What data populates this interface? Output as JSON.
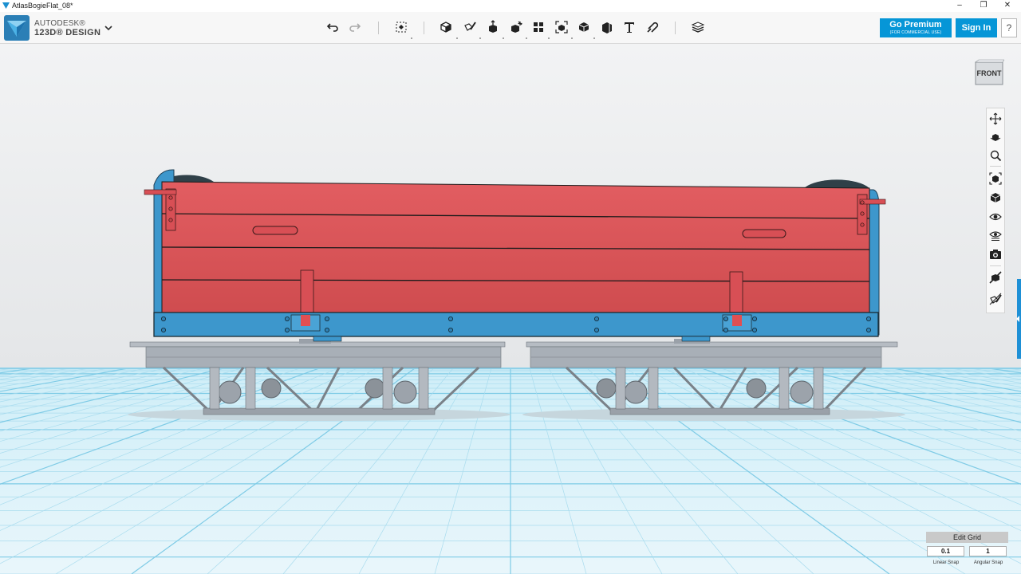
{
  "window": {
    "title": "AtlasBogieFlat_08*",
    "controls": [
      "minimize-icon",
      "maximize-icon",
      "close-icon"
    ]
  },
  "app": {
    "brand_line1": "AUTODESK®",
    "brand_line2": "123D® DESIGN",
    "accent": "#0696d7"
  },
  "toolbar": {
    "tools": [
      "undo-icon",
      "redo-icon",
      "transform-icon",
      "primitives-icon",
      "sketch-icon",
      "construct-icon",
      "modify-icon",
      "pattern-icon",
      "grouping-icon",
      "combine-icon",
      "measure-icon",
      "text-icon",
      "snap-icon",
      "materials-icon"
    ],
    "premium_label": "Go Premium",
    "premium_sub": "(FOR COMMERCIAL USE)",
    "signin_label": "Sign In",
    "help_label": "?"
  },
  "viewcube": {
    "face": "FRONT"
  },
  "navbar": {
    "tools": [
      "pan-icon",
      "orbit-icon",
      "zoom-icon",
      "fit-icon",
      "view-icon",
      "visibility-icon",
      "material-view-icon",
      "camera-icon",
      "outline-icon",
      "hide-sketch-icon"
    ]
  },
  "model": {
    "body_color": "#d85457",
    "frame_color": "#3d97cc",
    "bogie_color": "#a3aab2"
  },
  "grid": {
    "edit_label": "Edit Grid",
    "linear_value": "0.1",
    "linear_label": "Linear Snap",
    "angular_value": "1",
    "angular_label": "Angular Snap"
  }
}
